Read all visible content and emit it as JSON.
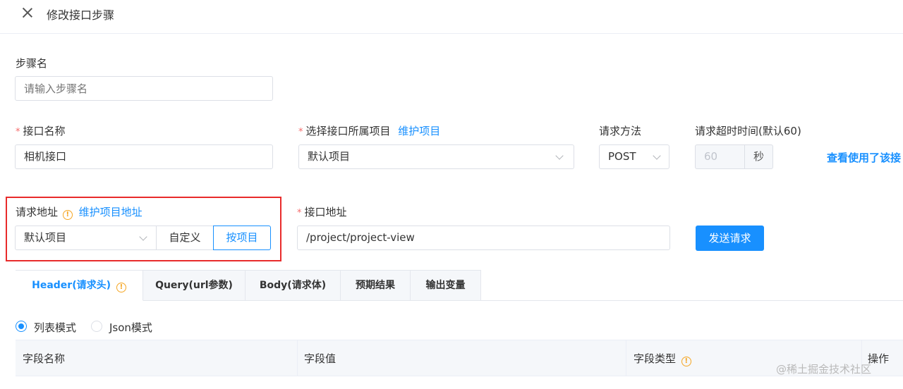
{
  "header": {
    "title": "修改接口步骤"
  },
  "step_name": {
    "label": "步骤名",
    "placeholder": "请输入步骤名"
  },
  "api_name": {
    "required_mark": "*",
    "label": "接口名称",
    "value": "相机接口"
  },
  "project": {
    "required_mark": "*",
    "label": "选择接口所属项目",
    "link": "维护项目",
    "value": "默认项目"
  },
  "method": {
    "label": "请求方法",
    "value": "POST"
  },
  "timeout": {
    "label": "请求超时时间(默认60)",
    "value": "60",
    "unit": "秒"
  },
  "usage_link": "查看使用了该接",
  "request_url": {
    "label": "请求地址",
    "link": "维护项目地址",
    "select_value": "默认项目",
    "option_custom": "自定义",
    "option_by_project": "按项目"
  },
  "api_path": {
    "required_mark": "*",
    "label": "接口地址",
    "value": "/project/project-view"
  },
  "send_button": "发送请求",
  "tabs": [
    {
      "label": "Header(请求头)"
    },
    {
      "label": "Query(url参数)"
    },
    {
      "label": "Body(请求体)"
    },
    {
      "label": "预期结果"
    },
    {
      "label": "输出变量"
    }
  ],
  "mode": {
    "list": "列表模式",
    "json": "Json模式"
  },
  "table": {
    "columns": [
      "字段名称",
      "字段值",
      "字段类型",
      "操作"
    ]
  },
  "info_glyph": "!",
  "watermark": "@稀土掘金技术社区",
  "colors": {
    "primary": "#1890ff",
    "required": "#f56c6c",
    "warning": "#f5a623",
    "highlight_box": "#e82b2b"
  }
}
